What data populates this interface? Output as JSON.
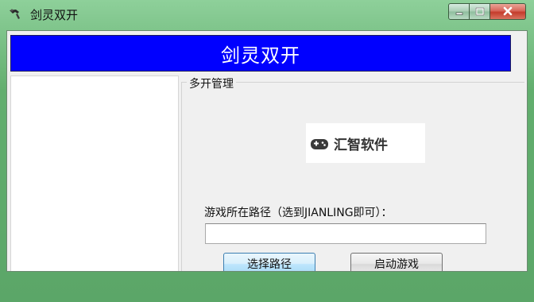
{
  "window": {
    "title": "剑灵双开"
  },
  "caption": {
    "minimize": "minimize",
    "maximize": "maximize",
    "close": "close"
  },
  "header": {
    "title": "剑灵双开",
    "background_color": "#0000ff",
    "text_color": "#ffffff"
  },
  "group": {
    "title": "多开管理"
  },
  "watermark": {
    "text": "汇智软件",
    "icon": "gamepad-icon"
  },
  "path": {
    "label": "游戏所在路径（选到JIANLING即可）：",
    "value": "",
    "placeholder": ""
  },
  "buttons": {
    "select_path": "选择路径",
    "start_game": "启动游戏"
  }
}
